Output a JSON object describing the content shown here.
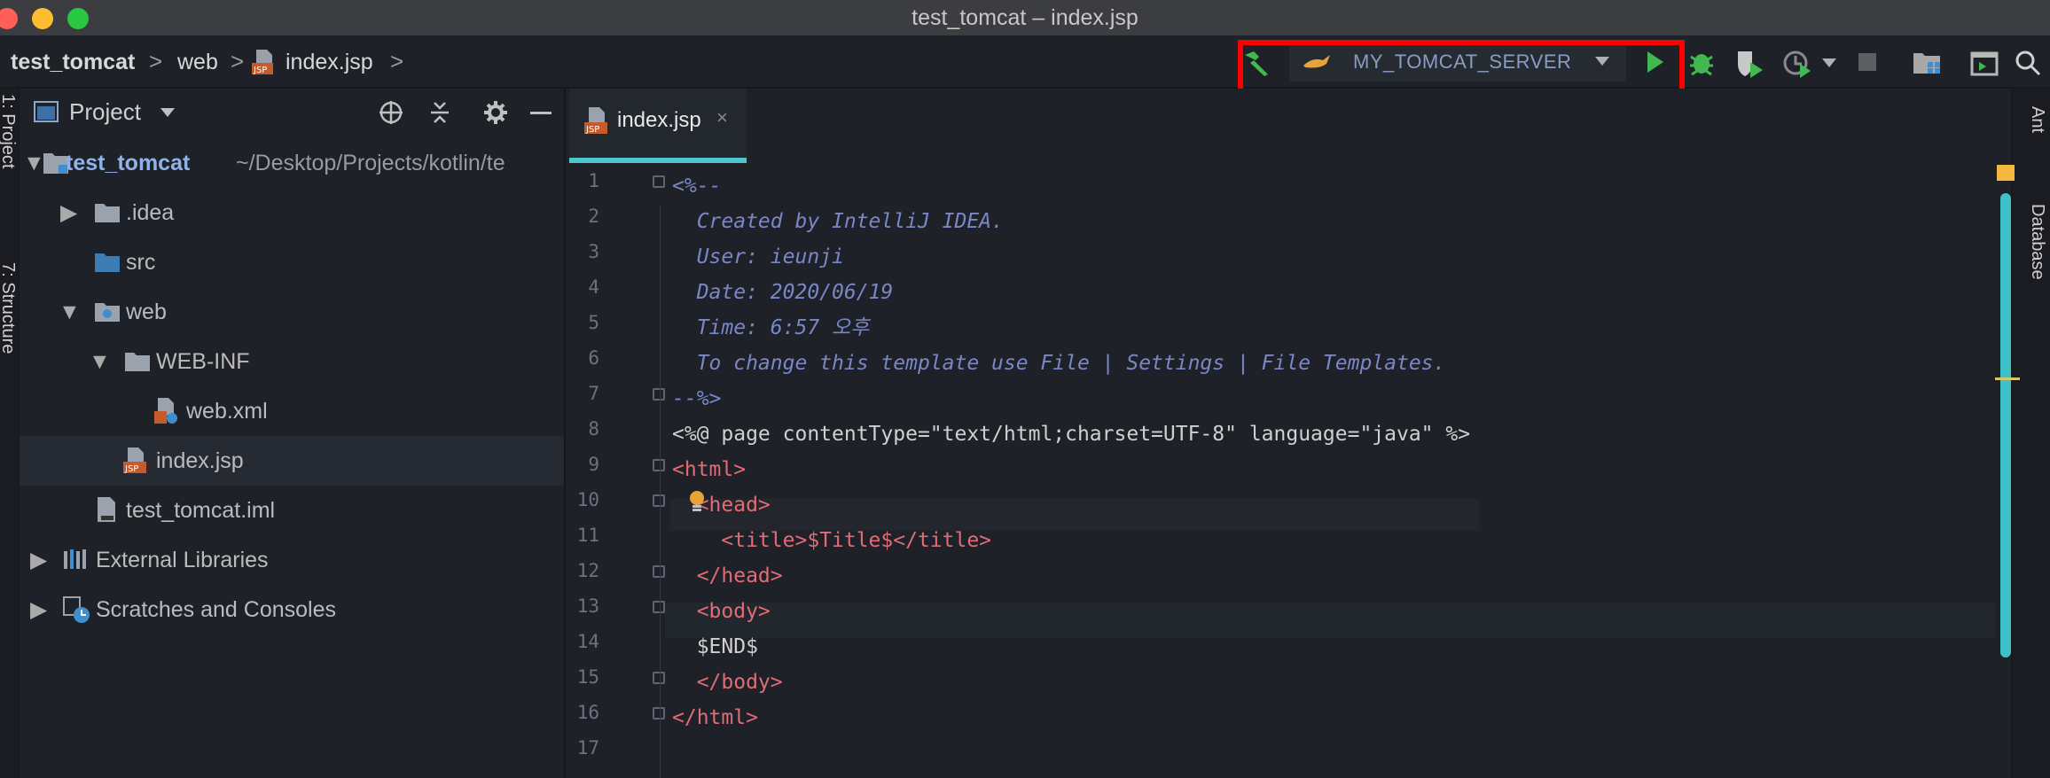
{
  "window": {
    "title": "test_tomcat – index.jsp"
  },
  "breadcrumb": {
    "project": "test_tomcat",
    "folder": "web",
    "file": "index.jsp",
    "sep": ">"
  },
  "toolbar": {
    "run_config_label": "MY_TOMCAT_SERVER",
    "icons": [
      "build-hammer-icon",
      "tomcat-icon",
      "dropdown-caret-icon",
      "run-icon",
      "debug-icon",
      "coverage-icon",
      "profile-icon",
      "stop-icon",
      "project-structure-icon",
      "terminal-icon",
      "search-icon"
    ],
    "colors": {
      "highlight": "#ff0000",
      "run": "#3fb950",
      "hammer": "#3fb950"
    }
  },
  "left_stripe": {
    "project_tab": "1: Project",
    "structure_tab": "7: Structure"
  },
  "right_stripe": {
    "ant_tab": "Ant",
    "database_tab": "Database"
  },
  "project_panel": {
    "title": "Project",
    "tree": [
      {
        "label": "test_tomcat",
        "path": "~/Desktop/Projects/kotlin/te",
        "expanded": true,
        "bold": true
      },
      {
        "label": ".idea",
        "expanded": false
      },
      {
        "label": "src"
      },
      {
        "label": "web",
        "expanded": true
      },
      {
        "label": "WEB-INF",
        "expanded": true
      },
      {
        "label": "web.xml"
      },
      {
        "label": "index.jsp",
        "selected": true
      },
      {
        "label": "test_tomcat.iml"
      },
      {
        "label": "External Libraries",
        "expanded": false
      },
      {
        "label": "Scratches and Consoles",
        "expanded": false
      }
    ]
  },
  "editor": {
    "tab_label": "index.jsp",
    "tab_close": "×",
    "current_line": 11,
    "line_numbers": [
      "1",
      "2",
      "3",
      "4",
      "5",
      "6",
      "7",
      "8",
      "9",
      "10",
      "11",
      "12",
      "13",
      "14",
      "15",
      "16",
      "17"
    ],
    "lines": [
      "<%--",
      "  Created by IntelliJ IDEA.",
      "  User: ieunji",
      "  Date: 2020/06/19",
      "  Time: 6:57 오후",
      "  To change this template use File | Settings | File Templates.",
      "--%>",
      "<%@ page contentType=\"text/html;charset=UTF-8\" language=\"java\" %>",
      "<html>",
      "  <head>",
      "    <title>$Title$</title>",
      "  </head>",
      "  <body>",
      "  $END$",
      "  </body>",
      "</html>",
      ""
    ]
  }
}
